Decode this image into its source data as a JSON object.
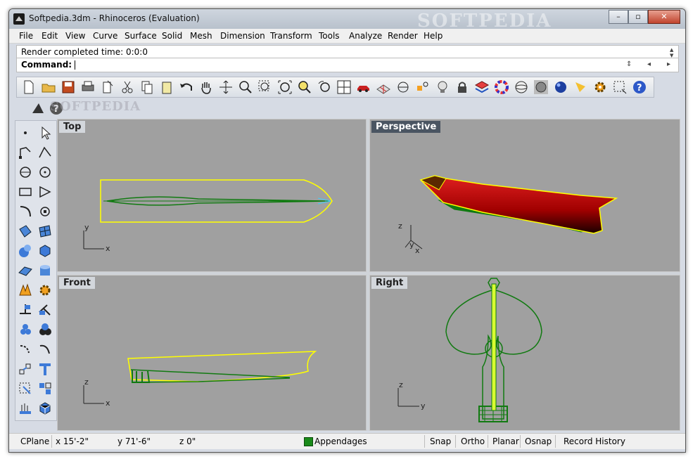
{
  "window": {
    "title": "Softpedia.3dm - Rhinoceros (Evaluation)",
    "watermark": "SOFTPEDIA",
    "min_label": "–",
    "max_label": "▫",
    "close_label": "✕"
  },
  "menu": [
    "File",
    "Edit",
    "View",
    "Curve",
    "Surface",
    "Solid",
    "Mesh",
    "Dimension",
    "Transform",
    "Tools",
    "Analyze",
    "Render",
    "Help"
  ],
  "command_history": "Render completed time: 0:0:0",
  "command": {
    "label": "Command:",
    "value": ""
  },
  "toolbar2_watermark": "SOFTPEDIA",
  "toolbar_icons": [
    "new-file",
    "open-folder",
    "save",
    "print",
    "import",
    "cut",
    "copy",
    "paste",
    "undo",
    "pan-hand",
    "rotate-view",
    "zoom",
    "zoom-window",
    "zoom-extents",
    "zoom-selected",
    "undo-view",
    "four-viewports",
    "car",
    "mesh-plane",
    "cplane",
    "point",
    "light-bulb",
    "lock",
    "layer",
    "color-wheel",
    "sphere-wire",
    "sphere-render",
    "sphere-blue",
    "spotlight",
    "gear",
    "options",
    "help"
  ],
  "left_tool_icons": [
    "point",
    "select-arrow",
    "polyline",
    "polygon-curve",
    "circle",
    "circle-center",
    "rectangle",
    "triangle",
    "arc",
    "ellipse",
    "surface-patch",
    "surface-grid",
    "solid-spheres",
    "solid-box",
    "surface-network",
    "cylinder",
    "explode",
    "settings-gear",
    "dimension",
    "trim",
    "boolean",
    "boolean-union",
    "fillet",
    "arc-edge",
    "array",
    "text",
    "transform",
    "group",
    "render-pattern",
    "render-box"
  ],
  "viewports": {
    "top": {
      "label": "Top",
      "axis_x": "x",
      "axis_y": "y"
    },
    "perspective": {
      "label": "Perspective",
      "axis_x": "x",
      "axis_y": "y",
      "axis_z": "z"
    },
    "front": {
      "label": "Front",
      "axis_x": "x",
      "axis_y": "z"
    },
    "right": {
      "label": "Right",
      "axis_x": "y",
      "axis_y": "z"
    }
  },
  "colors": {
    "viewport_bg": "#a0a0a0",
    "hull_outline": "#ffff00",
    "appendage": "#117a11",
    "hull_render": "#c01010"
  },
  "status": {
    "cplane": "CPlane",
    "x": "x 15'-2\"",
    "y": "y 71'-6\"",
    "z": "z 0\"",
    "layer": "Appendages",
    "snap": "Snap",
    "ortho": "Ortho",
    "planar": "Planar",
    "osnap": "Osnap",
    "record_history": "Record History"
  }
}
